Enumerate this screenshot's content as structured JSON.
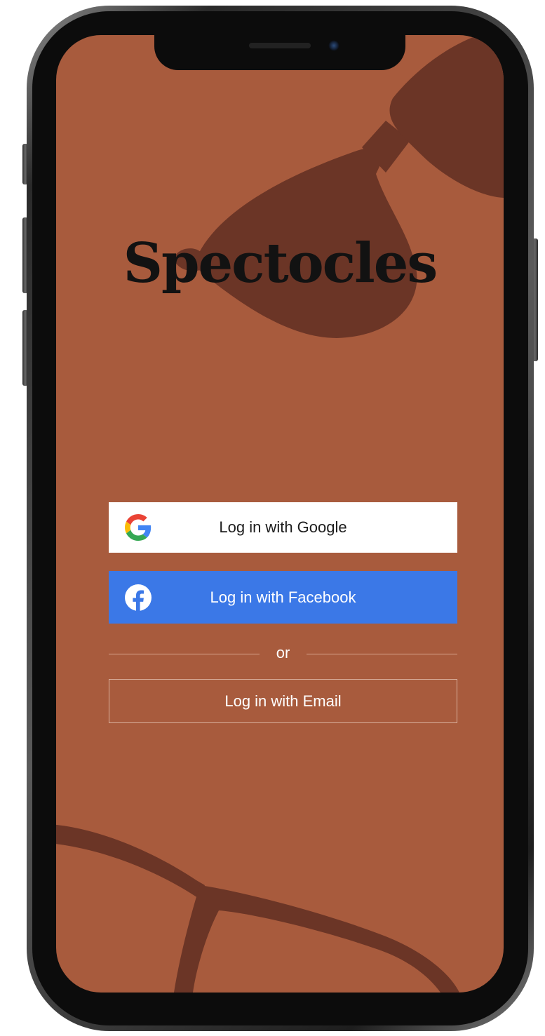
{
  "app": {
    "title": "Spectocles"
  },
  "login": {
    "google_label": "Log in with Google",
    "facebook_label": "Log in with Facebook",
    "divider_label": "or",
    "email_label": "Log in with Email"
  },
  "icons": {
    "google": "google-g-logo-icon",
    "facebook": "facebook-f-logo-icon"
  },
  "colors": {
    "background": "#a85b3d",
    "decoration": "#6b3526",
    "facebook_blue": "#3b78e7",
    "google_white": "#ffffff",
    "title_text": "#121212"
  }
}
